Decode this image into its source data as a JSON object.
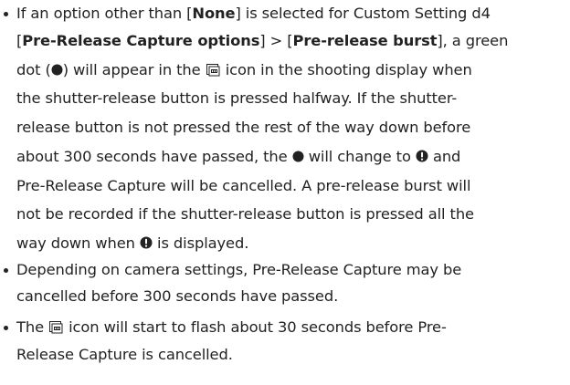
{
  "bullets": [
    {
      "segments": {
        "l1a": "If an option other than [",
        "l1b": "None",
        "l1c": "] is selected for Custom Setting d4",
        "l2a": "[",
        "l2b": "Pre-Release Capture options",
        "l2c": "] > [",
        "l2d": "Pre-release burst",
        "l2e": "], a green",
        "l3a": "dot (",
        "l3b": ") will appear in the ",
        "l3c": " icon in the shooting display when",
        "l4": "the shutter-release button is pressed halfway. If the shutter-",
        "l5": "release button is not pressed the rest of the way down before",
        "l6a": "about 300 seconds have passed, the ",
        "l6b": " will change to ",
        "l6c": " and",
        "l7": "Pre-Release Capture will be cancelled. A pre-release burst will",
        "l8": "not be recorded if the shutter-release button is pressed all the",
        "l9a": "way down when ",
        "l9b": " is displayed."
      }
    },
    {
      "segments": {
        "l1": "Depending on camera settings, Pre-Release Capture may be",
        "l2": "cancelled before 300 seconds have passed."
      }
    },
    {
      "segments": {
        "l1a": "The ",
        "l1b": " icon will start to flash about 30 seconds before Pre-",
        "l2": "Release Capture is cancelled."
      }
    }
  ],
  "icons": {
    "dot": "filled-circle-icon",
    "warning": "exclamation-circle-icon",
    "pre_release": "pre-release-capture-icon"
  },
  "colors": {
    "text": "#222222"
  }
}
